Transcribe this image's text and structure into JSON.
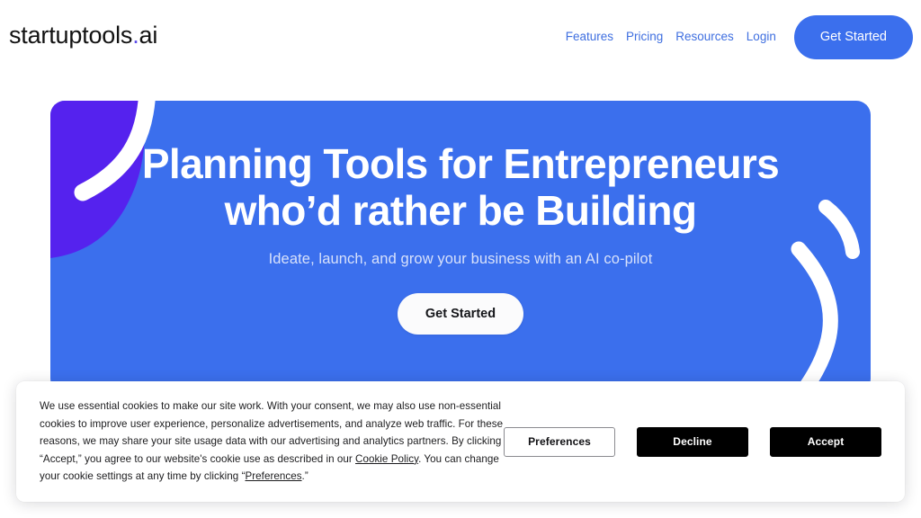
{
  "header": {
    "logo_main": "startuptools",
    "logo_dot": ".",
    "logo_suffix": "ai",
    "nav": [
      {
        "label": "Features"
      },
      {
        "label": "Pricing"
      },
      {
        "label": "Resources"
      },
      {
        "label": "Login"
      }
    ],
    "cta_label": "Get Started"
  },
  "hero": {
    "title": "Planning Tools for Entrepreneurs who’d rather be Building",
    "subtitle": "Ideate, launch, and grow your business with an AI co-pilot",
    "cta_label": "Get Started",
    "background_color": "#3b6fed",
    "blob_color": "#5522ee",
    "arc_color": "#ffffff"
  },
  "cookie_banner": {
    "text_part_1": "We use essential cookies to make our site work. With your consent, we may also use non-essential cookies to improve user experience, personalize advertisements, and analyze web traffic. For these reasons, we may share your site usage data with our advertising and analytics partners. By clicking “Accept,” you agree to our website's cookie use as described in our ",
    "link_cookie_policy": "Cookie Policy",
    "text_part_2": ". You can change your cookie settings at any time by clicking “",
    "link_preferences": "Preferences",
    "text_part_3": ".”",
    "buttons": {
      "preferences": "Preferences",
      "decline": "Decline",
      "accept": "Accept"
    }
  },
  "colors": {
    "brand_blue": "#3b6fed",
    "brand_purple": "#5522ee",
    "nav_link": "#3f6fe0",
    "dark_button": "#000000"
  }
}
